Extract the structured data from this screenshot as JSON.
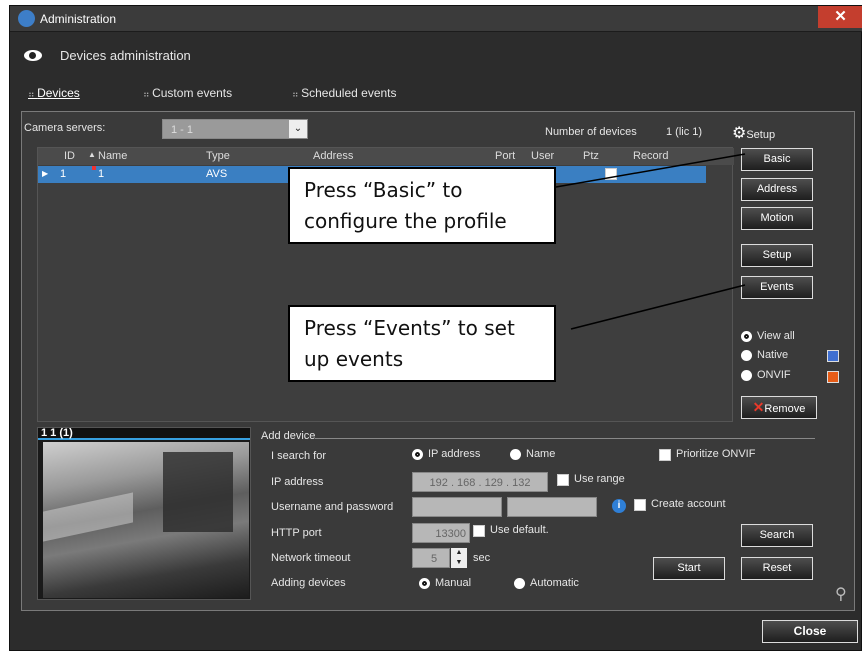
{
  "window": {
    "title": "Administration",
    "close_glyph": "✕"
  },
  "header": {
    "title": "Devices administration"
  },
  "tabs": [
    {
      "label": "Devices"
    },
    {
      "label": "Custom events"
    },
    {
      "label": "Scheduled events"
    }
  ],
  "servers": {
    "label": "Camera servers:",
    "value": "1 - 1",
    "count_label": "Number of devices",
    "count_value": "1 (lic 1)",
    "setup_label": "Setup"
  },
  "table": {
    "columns": [
      "ID",
      "Name",
      "Type",
      "Address",
      "Port",
      "User",
      "Ptz",
      "Record"
    ],
    "rows": [
      {
        "id": "1",
        "name": "1",
        "type": "AVS"
      }
    ]
  },
  "side_buttons": [
    "Basic",
    "Address",
    "Motion",
    "Setup",
    "Events"
  ],
  "filters": {
    "view_all": "View all",
    "native": "Native",
    "onvif": "ONVIF",
    "native_color": "#3f6fd1",
    "onvif_color": "#e65c17"
  },
  "remove_label": "Remove",
  "preview": {
    "label": "1  1 (1)"
  },
  "add": {
    "title": "Add device",
    "search_for": "I search for",
    "ip_option": "IP address",
    "name_option": "Name",
    "prioritize": "Prioritize ONVIF",
    "ip_label": "IP address",
    "ip_value": "192 . 168 . 129 . 132",
    "use_range": "Use range",
    "cred_label": "Username and password",
    "create_account": "Create account",
    "http_label": "HTTP port",
    "http_value": "13300",
    "use_default": "Use default.",
    "timeout_label": "Network timeout",
    "timeout_value": "5",
    "timeout_unit": "sec",
    "adding_label": "Adding devices",
    "manual": "Manual",
    "automatic": "Automatic",
    "search_btn": "Search",
    "start_btn": "Start",
    "reset_btn": "Reset"
  },
  "close_btn": "Close",
  "callouts": {
    "basic": "Press “Basic” to configure the profile",
    "events": "Press “Events” to set up events"
  }
}
